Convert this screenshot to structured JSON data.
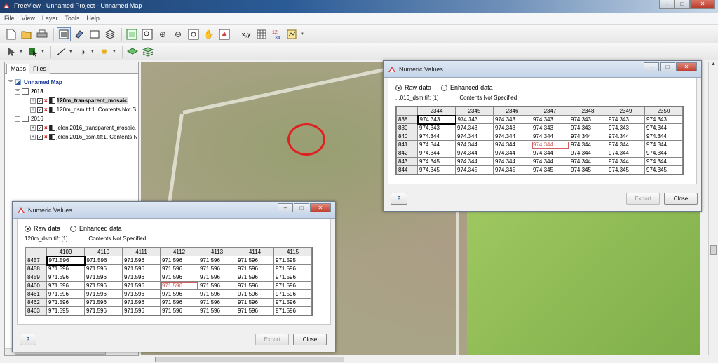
{
  "window": {
    "title": "FreeView - Unnamed Project - Unnamed Map"
  },
  "menu": [
    "File",
    "View",
    "Layer",
    "Tools",
    "Help"
  ],
  "toolbar": {
    "xy_label": "x,y",
    "digits_label": "12\n34"
  },
  "tabs": [
    "Maps",
    "Files"
  ],
  "tree": {
    "root": "Unnamed Map",
    "groups": [
      {
        "name": "2018",
        "items": [
          "120m_transparent_mosaic",
          "120m_dsm.tif:1. Contents Not S"
        ]
      },
      {
        "name": "2016",
        "items": [
          "jeleni2016_transparent_mosaic.",
          "jeleni2016_dsm.tif:1. Contents N"
        ]
      }
    ]
  },
  "scroll_marker": "III",
  "dialog_a": {
    "title": "Numeric Values",
    "raw": "Raw data",
    "enhanced": "Enhanced data",
    "source": "...016_dsm.tif: [1]",
    "contents": "Contents Not Specified",
    "columns": [
      "2344",
      "2345",
      "2346",
      "2347",
      "2348",
      "2349",
      "2350"
    ],
    "rows": [
      {
        "id": "838",
        "v": [
          "974.343",
          "974.343",
          "974.343",
          "974.343",
          "974.343",
          "974.343",
          "974.343"
        ]
      },
      {
        "id": "839",
        "v": [
          "974.343",
          "974.343",
          "974.343",
          "974.343",
          "974.343",
          "974.343",
          "974.344"
        ]
      },
      {
        "id": "840",
        "v": [
          "974.344",
          "974.344",
          "974.344",
          "974.344",
          "974.344",
          "974.344",
          "974.344"
        ]
      },
      {
        "id": "841",
        "v": [
          "974.344",
          "974.344",
          "974.344",
          "974.344",
          "974.344",
          "974.344",
          "974.344"
        ]
      },
      {
        "id": "842",
        "v": [
          "974.344",
          "974.344",
          "974.344",
          "974.344",
          "974.344",
          "974.344",
          "974.344"
        ]
      },
      {
        "id": "843",
        "v": [
          "974.345",
          "974.344",
          "974.344",
          "974.344",
          "974.344",
          "974.344",
          "974.344"
        ]
      },
      {
        "id": "844",
        "v": [
          "974.345",
          "974.345",
          "974.345",
          "974.345",
          "974.345",
          "974.345",
          "974.345"
        ]
      }
    ],
    "export": "Export",
    "close": "Close"
  },
  "dialog_b": {
    "title": "Numeric Values",
    "raw": "Raw data",
    "enhanced": "Enhanced data",
    "source": "120m_dsm.tif: [1]",
    "contents": "Contents Not Specified",
    "columns": [
      "4109",
      "4110",
      "4111",
      "4112",
      "4113",
      "4114",
      "4115"
    ],
    "rows": [
      {
        "id": "8457",
        "v": [
          "971.596",
          "971.596",
          "971.596",
          "971.596",
          "971.596",
          "971.596",
          "971.595"
        ]
      },
      {
        "id": "8458",
        "v": [
          "971.596",
          "971.596",
          "971.596",
          "971.596",
          "971.596",
          "971.596",
          "971.596"
        ]
      },
      {
        "id": "8459",
        "v": [
          "971.596",
          "971.596",
          "971.596",
          "971.596",
          "971.596",
          "971.596",
          "971.596"
        ]
      },
      {
        "id": "8460",
        "v": [
          "971.596",
          "971.596",
          "971.596",
          "971.596",
          "971.596",
          "971.596",
          "971.596"
        ]
      },
      {
        "id": "8461",
        "v": [
          "971.596",
          "971.596",
          "971.596",
          "971.596",
          "971.596",
          "971.596",
          "971.596"
        ]
      },
      {
        "id": "8462",
        "v": [
          "971.596",
          "971.596",
          "971.596",
          "971.596",
          "971.596",
          "971.596",
          "971.596"
        ]
      },
      {
        "id": "8463",
        "v": [
          "971.595",
          "971.596",
          "971.596",
          "971.596",
          "971.596",
          "971.596",
          "971.596"
        ]
      }
    ],
    "export": "Export",
    "close": "Close"
  },
  "colors": {
    "highlight": "#d06060",
    "marker": "#e02020",
    "title_bar": "#2b5b96"
  },
  "icons": [
    "app-icon",
    "new-icon",
    "open-icon",
    "print-icon",
    "map-icon",
    "eraser-icon",
    "frame-icon",
    "layers-icon",
    "zoom-extent-icon",
    "zoom-box-icon",
    "zoom-in-icon",
    "zoom-out-icon",
    "zoom-window-icon",
    "pan-hand-icon",
    "zoom-layer-icon",
    "coordinates-icon",
    "grid-icon",
    "numeric-values-icon",
    "profile-icon",
    "pointer-icon",
    "select-icon",
    "measure-icon",
    "contrast-icon",
    "sun-icon",
    "layer-green-icon",
    "layer-stack-icon",
    "help-icon"
  ]
}
